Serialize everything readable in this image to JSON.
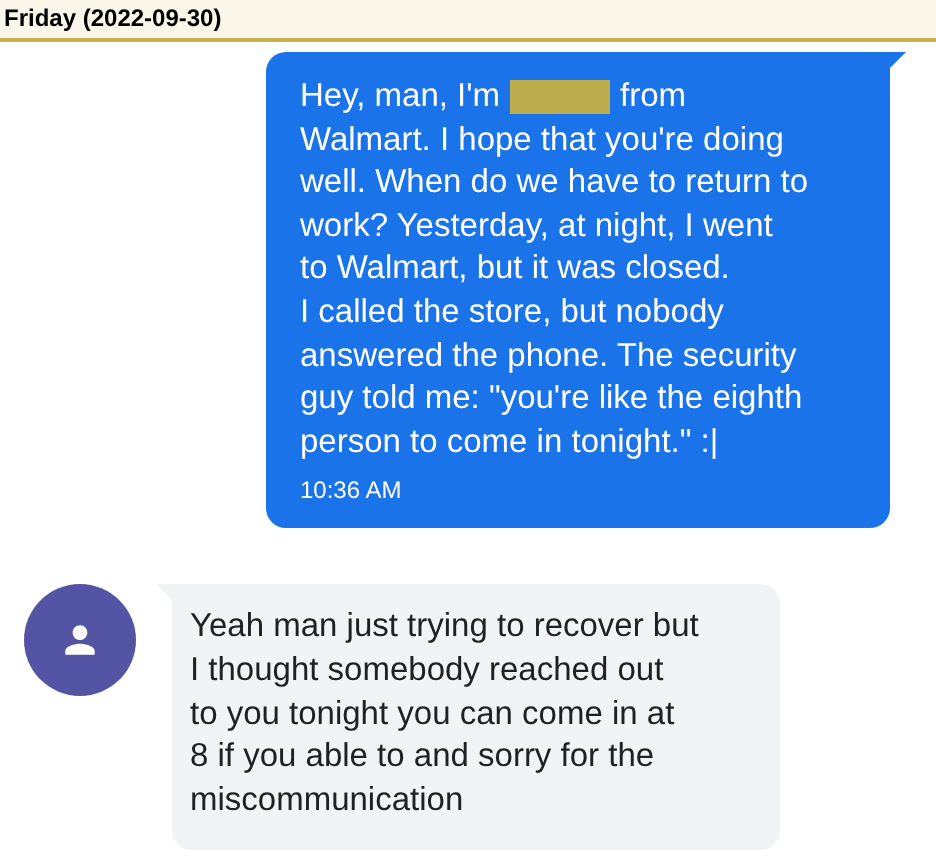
{
  "header": {
    "date": "Friday (2022-09-30)"
  },
  "messages": [
    {
      "kind": "outgoing",
      "lines": [
        [
          {
            "kind": "text",
            "text": "Hey, man, I'm"
          },
          {
            "kind": "redaction"
          },
          {
            "kind": "text",
            "text": "from"
          }
        ],
        [
          {
            "kind": "text",
            "text": "Walmart. I hope that you're doing"
          }
        ],
        [
          {
            "kind": "text",
            "text": "well. When do we have to return to"
          }
        ],
        [
          {
            "kind": "text",
            "text": "work? Yesterday, at night, I went"
          }
        ],
        [
          {
            "kind": "text",
            "text": "to Walmart, but it was closed."
          }
        ],
        [
          {
            "kind": "text",
            "text": "I called the store, but nobody"
          }
        ],
        [
          {
            "kind": "text",
            "text": "answered the phone. The security"
          }
        ],
        [
          {
            "kind": "text",
            "text": "guy told me: \"you're like the eighth"
          }
        ],
        [
          {
            "kind": "text",
            "text": "person to come in tonight.\" :|"
          }
        ]
      ],
      "time": "10:36 AM"
    },
    {
      "kind": "incoming",
      "lines": [
        "Yeah man just trying to recover but",
        "I thought somebody reached out",
        "to you tonight you can come in at",
        "8 if you able to and sorry for the",
        "miscommunication"
      ]
    }
  ]
}
